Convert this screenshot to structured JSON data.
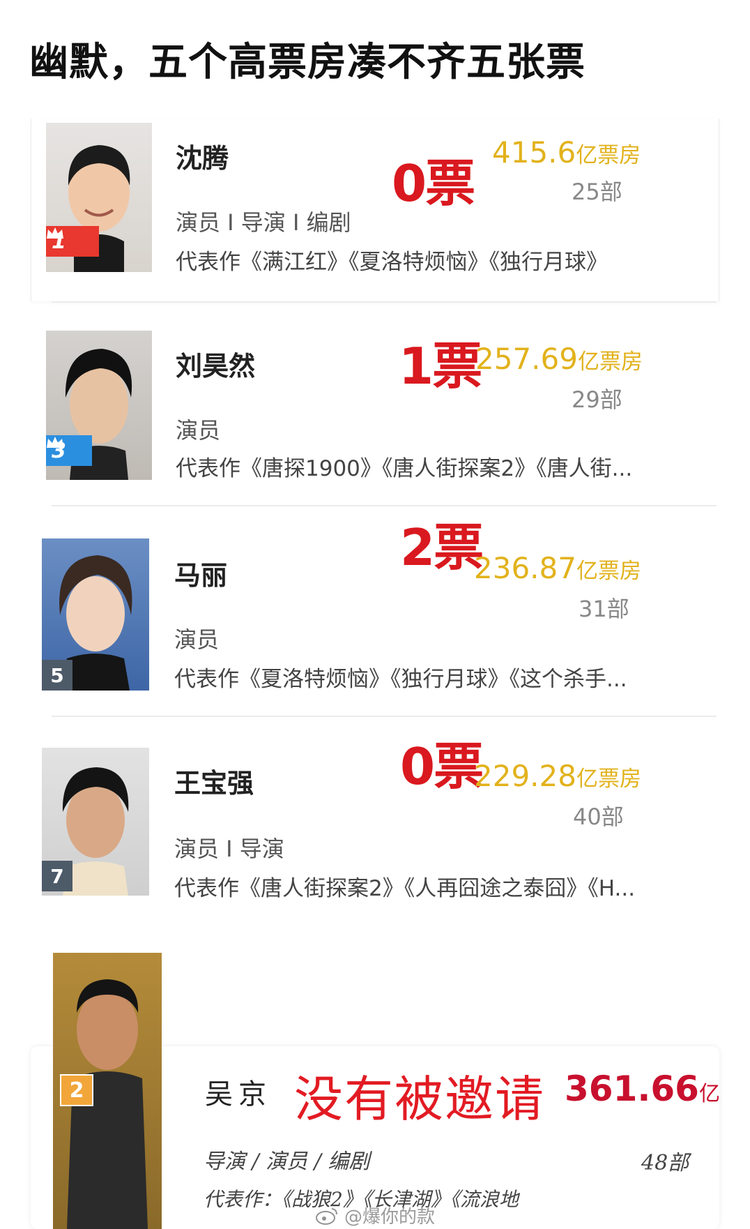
{
  "page": {
    "title": "幽默，五个高票房凑不齐五张票"
  },
  "colors": {
    "votes_red": "#d9191f",
    "box_office_gold": "#e2b21c",
    "rank1_bg": "#e8382f",
    "rank3_bg": "#2b8fe0",
    "rank_plain_bg": "#4d5a68",
    "rank2_bg": "#f2a63a"
  },
  "people": [
    {
      "name": "沈腾",
      "votes": "0票",
      "box_office_value": "415.6",
      "box_office_unit": "亿票房",
      "count": "25部",
      "roles": "演员 I 导演 I 编剧",
      "works": "代表作《满江红》《夏洛特烦恼》《独行月球》",
      "rank": "1",
      "rank_icon": "crown-icon"
    },
    {
      "name": "刘昊然",
      "votes": "1票",
      "box_office_value": "257.69",
      "box_office_unit": "亿票房",
      "count": "29部",
      "roles": "演员",
      "works": "代表作《唐探1900》《唐人街探案2》《唐人街...",
      "rank": "3",
      "rank_icon": "crown-icon"
    },
    {
      "name": "马丽",
      "votes": "2票",
      "box_office_value": "236.87",
      "box_office_unit": "亿票房",
      "count": "31部",
      "roles": "演员",
      "works": "代表作《夏洛特烦恼》《独行月球》《这个杀手...",
      "rank": "5"
    },
    {
      "name": "王宝强",
      "votes": "0票",
      "box_office_value": "229.28",
      "box_office_unit": "亿票房",
      "count": "40部",
      "roles": "演员 I 导演",
      "works": "代表作《唐人街探案2》《人再囧途之泰囧》《H...",
      "rank": "7"
    }
  ],
  "wu": {
    "name": "吴京",
    "status": "没有被邀请",
    "box_office_value": "361.66",
    "box_office_unit": "亿",
    "count": "48部",
    "roles": "导演 / 演员 / 编剧",
    "works": "代表作：《战狼2》《长津湖》《流浪地",
    "rank": "2"
  },
  "watermark": {
    "text": "@爆你的款",
    "icon": "weibo-icon"
  }
}
